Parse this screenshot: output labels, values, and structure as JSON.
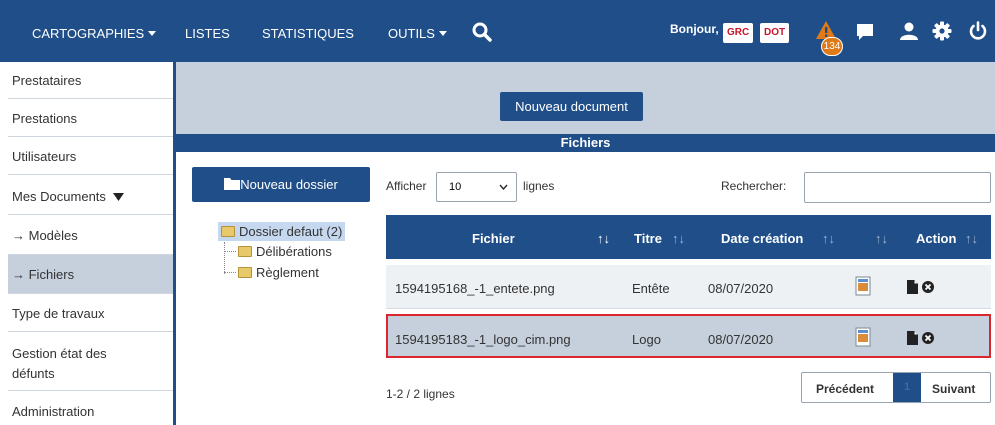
{
  "topbar": {
    "menu_cartographies": "CARTOGRAPHIES",
    "menu_listes": "LISTES",
    "menu_statistiques": "STATISTIQUES",
    "menu_outils": "OUTILS",
    "greeting": "Bonjour,",
    "badge_grc": "GRC",
    "badge_dot": "DOT",
    "alert_count": "134",
    "icons": [
      "search-icon",
      "warning-icon",
      "chat-icon",
      "user-icon",
      "gear-icon",
      "power-icon"
    ],
    "colors": {
      "bar": "#1f4e89",
      "badge_text": "#c8142c",
      "alert": "#e07a18"
    }
  },
  "sidebar": {
    "items": [
      {
        "label": "Prestataires"
      },
      {
        "label": "Prestations"
      },
      {
        "label": "Utilisateurs"
      },
      {
        "label": "Mes Documents"
      },
      {
        "label": "→ Modèles"
      },
      {
        "label": "→ Fichiers"
      },
      {
        "label": "Type de travaux"
      },
      {
        "label": "Gestion état des"
      },
      {
        "label": "défunts"
      },
      {
        "label": "Administration"
      }
    ]
  },
  "main": {
    "new_document_label": "Nouveau document",
    "files_title": "Fichiers",
    "new_folder_label": "Nouveau dossier",
    "tree": {
      "root": "Dossier defaut (2)",
      "children": [
        "Délibérations",
        "Règlement"
      ]
    },
    "show_label": "Afficher",
    "page_size_value": "10",
    "rows_label": "lignes",
    "search_label": "Rechercher:",
    "search_value": "",
    "table": {
      "headers": [
        "Fichier",
        "Titre",
        "Date création",
        "Action"
      ],
      "sort_glyph": "↑↓",
      "rows": [
        {
          "fichier": "1594195168_-1_entete.png",
          "titre": "Entête",
          "date": "08/07/2020"
        },
        {
          "fichier": "1594195183_-1_logo_cim.png",
          "titre": "Logo",
          "date": "08/07/2020"
        }
      ]
    },
    "info_label": "1-2 / 2 lignes",
    "pager": {
      "prev": "Précédent",
      "page": "1",
      "next": "Suivant"
    },
    "highlight_color": "#d9262f"
  }
}
